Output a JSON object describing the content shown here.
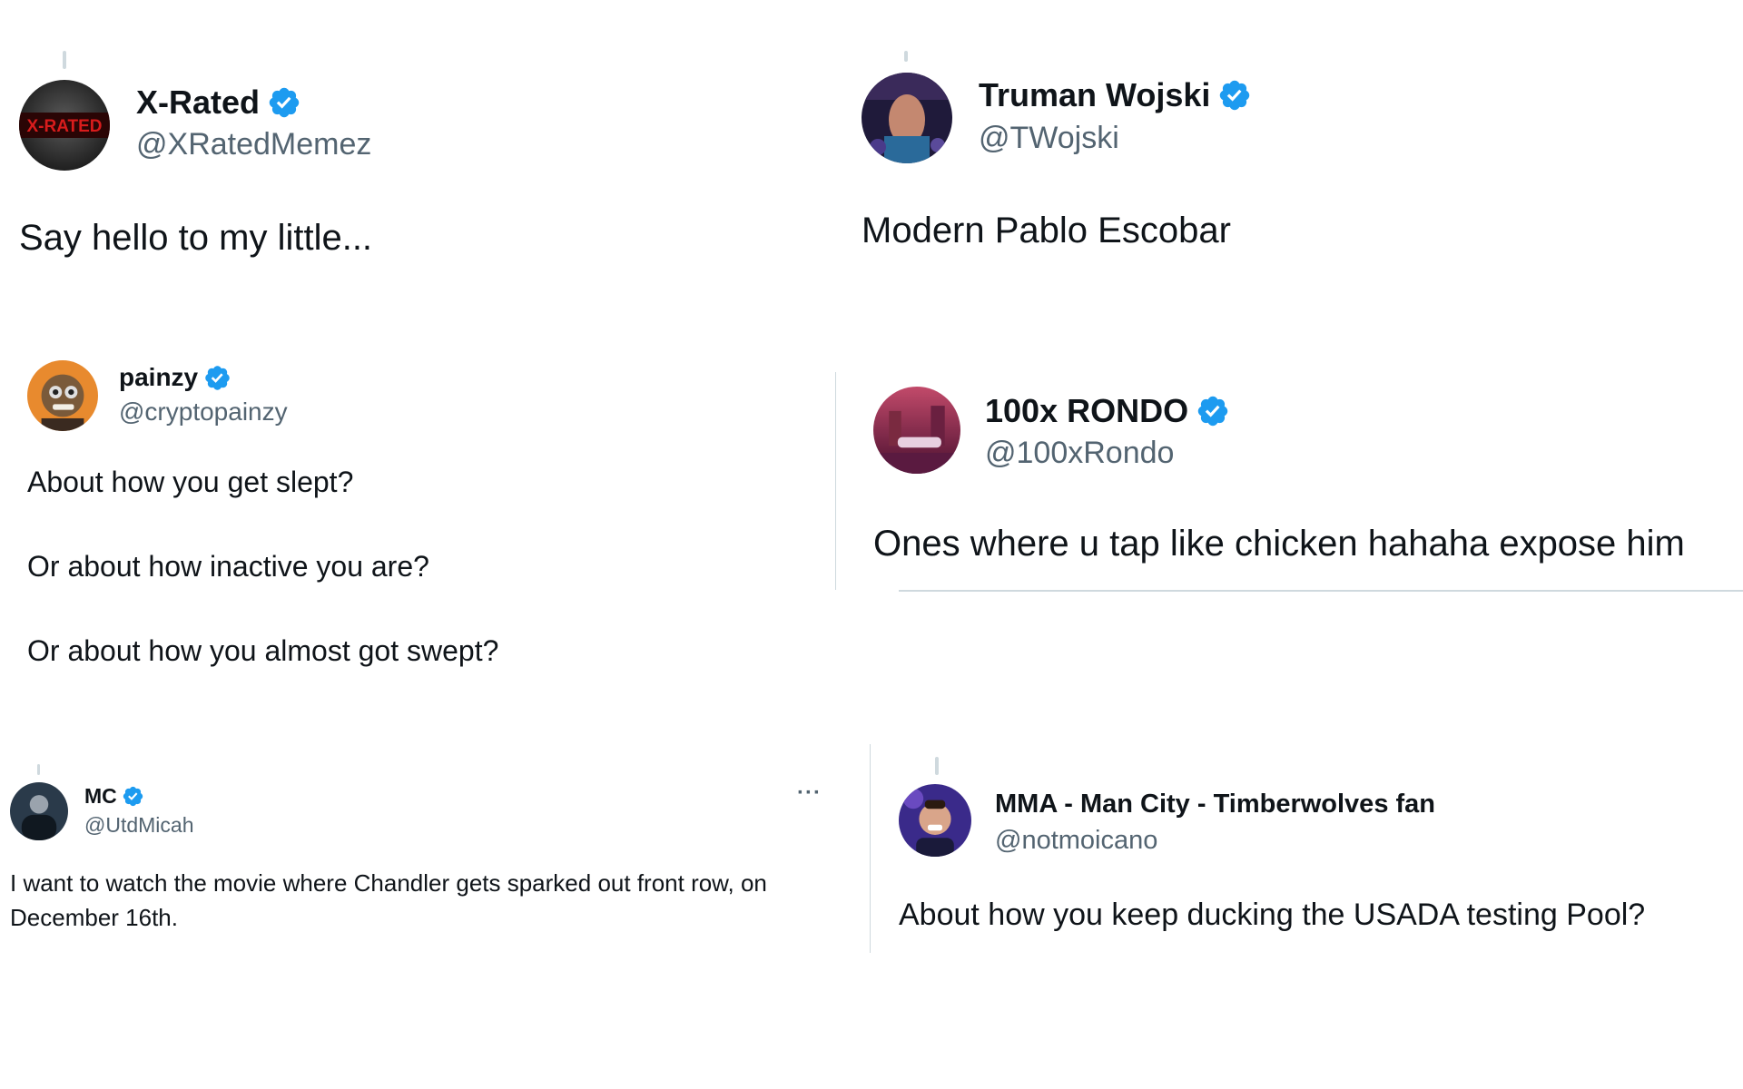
{
  "tweets": [
    {
      "name": "X-Rated",
      "handle": "@XRatedMemez",
      "avatar_text": "X-RATED",
      "text": "Say hello to my little..."
    },
    {
      "name": "Truman Wojski",
      "handle": "@TWojski",
      "text": "Modern Pablo Escobar"
    },
    {
      "name": "painzy",
      "handle": "@cryptopainzy",
      "lines": [
        "About how you get slept?",
        "Or about how inactive you are?",
        "Or about how you almost got swept?"
      ]
    },
    {
      "name": "100x RONDO",
      "handle": "@100xRondo",
      "text": "Ones where u tap like chicken hahaha expose him"
    },
    {
      "name": "MC",
      "handle": "@UtdMicah",
      "more": "···",
      "lines": [
        "I want to watch the movie where Chandler gets sparked out front row, on",
        "December 16th."
      ]
    },
    {
      "name": "MMA - Man City - Timberwolves fan",
      "handle": "@notmoicano",
      "text": "About how you keep ducking the USADA testing Pool?"
    }
  ],
  "colors": {
    "verified": "#1d9bf0",
    "text": "#0f1419",
    "secondary": "#536471",
    "line": "#cfd9de"
  }
}
